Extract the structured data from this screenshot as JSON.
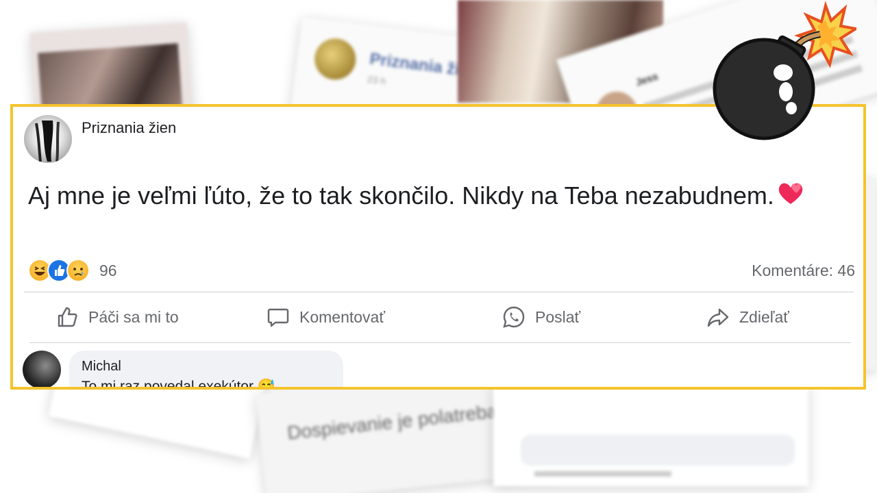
{
  "post": {
    "page_name": "Priznania žien",
    "text": "Aj mne je veľmi ľúto, že to tak skončilo. Nikdy na Teba nezabudnem.",
    "reactions": [
      "haha",
      "like",
      "sad"
    ],
    "reaction_count": "96",
    "comments_count": "Komentáre: 46"
  },
  "actions": {
    "like_label": "Páči sa mi to",
    "comment_label": "Komentovať",
    "send_label": "Poslať",
    "share_label": "Zdieľať"
  },
  "comment": {
    "author": "Michal",
    "text": "To mi raz povedal exekútor 😅"
  },
  "background": {
    "mid_card_name": "Priznania žien",
    "mid_card_time": "23 h",
    "tr_card_user": "Jess",
    "bottom_card_text": "Dospievanie je polatreba a ja som vidlička."
  },
  "colors": {
    "frame": "#f5c32c",
    "text_primary": "#1c1e21",
    "text_secondary": "#65676b",
    "like_blue": "#1b74e4"
  }
}
